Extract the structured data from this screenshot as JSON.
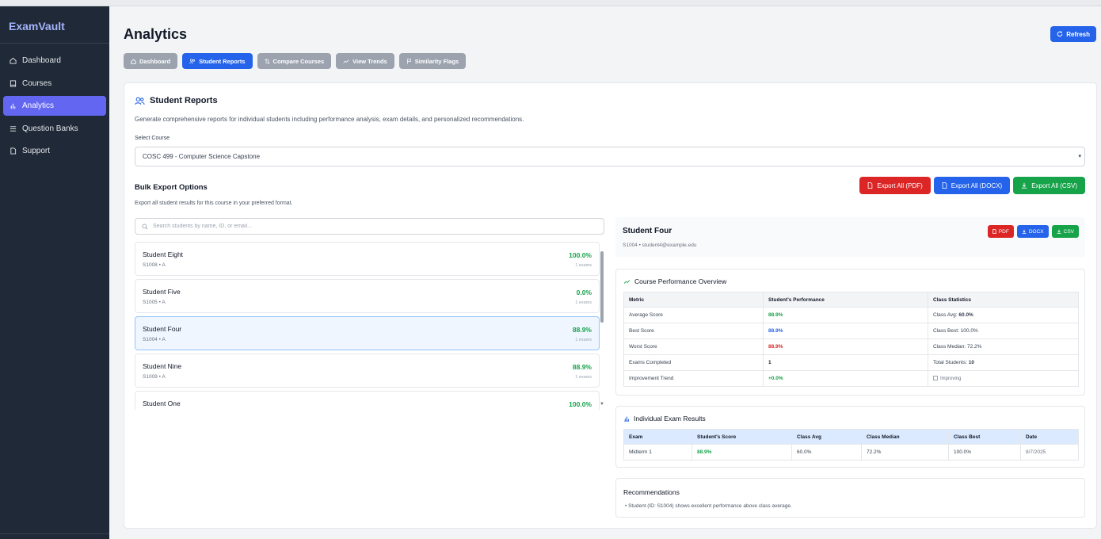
{
  "app": {
    "name": "ExamVault"
  },
  "sidebar": {
    "items": [
      {
        "label": "Dashboard",
        "icon": "home-icon",
        "active": false
      },
      {
        "label": "Courses",
        "icon": "book-icon",
        "active": false
      },
      {
        "label": "Analytics",
        "icon": "bar-chart-icon",
        "active": true
      },
      {
        "label": "Question Banks",
        "icon": "list-icon",
        "active": false
      },
      {
        "label": "Support",
        "icon": "document-icon",
        "active": false
      }
    ]
  },
  "header": {
    "title": "Analytics",
    "refresh_label": "Refresh"
  },
  "tabs": [
    {
      "label": "Dashboard",
      "icon": "home-icon"
    },
    {
      "label": "Student Reports",
      "icon": "users-icon",
      "active": true
    },
    {
      "label": "Compare Courses",
      "icon": "compare-icon"
    },
    {
      "label": "View Trends",
      "icon": "trend-icon"
    },
    {
      "label": "Similarity Flags",
      "icon": "flag-icon"
    }
  ],
  "report": {
    "title": "Student Reports",
    "description": "Generate comprehensive reports for individual students including performance analysis, exam details, and personalized recommendations.",
    "select_label": "Select Course",
    "selected_course": "COSC 499 - Computer Science Capstone",
    "bulk_title": "Bulk Export Options",
    "bulk_description": "Export all student results for this course in your preferred format.",
    "export_pdf": "Export All (PDF)",
    "export_docx": "Export All (DOCX)",
    "export_csv": "Export All (CSV)",
    "search_placeholder": "Search students by name, ID, or email..."
  },
  "students": [
    {
      "name": "Student Eight",
      "sub": "S1008 • A",
      "score": "100.0%",
      "exams": "1 exams"
    },
    {
      "name": "Student Five",
      "sub": "S1005 • A",
      "score": "0.0%",
      "exams": "1 exams"
    },
    {
      "name": "Student Four",
      "sub": "S1004 • A",
      "score": "88.9%",
      "exams": "1 exams",
      "selected": true
    },
    {
      "name": "Student Nine",
      "sub": "S1009 • A",
      "score": "88.9%",
      "exams": "1 exams"
    },
    {
      "name": "Student One",
      "sub": "",
      "score": "100.0%",
      "exams": ""
    }
  ],
  "detail": {
    "name": "Student Four",
    "sub": "S1004 • student4@example.edu",
    "pdf": "PDF",
    "docx": "DOCX",
    "csv": "CSV",
    "overview_title": "Course Performance Overview",
    "overview_headers": [
      "Metric",
      "Student's Performance",
      "Class Statistics"
    ],
    "overview_rows": [
      {
        "metric": "Average Score",
        "value": "88.9%",
        "stat_label": "Class Avg:",
        "stat_value": "60.0%"
      },
      {
        "metric": "Best Score",
        "value": "88.9%",
        "stat_label": "Class Best:",
        "stat_value": "100.0%"
      },
      {
        "metric": "Worst Score",
        "value": "88.9%",
        "stat_label": "Class Median:",
        "stat_value": "72.2%"
      },
      {
        "metric": "Exams Completed",
        "value": "1",
        "stat_label": "Total Students:",
        "stat_value": "10"
      },
      {
        "metric": "Improvement Trend",
        "value": "+0.0%",
        "stat_label": "Improving",
        "stat_value": ""
      }
    ],
    "exam_title": "Individual Exam Results",
    "exam_headers": [
      "Exam",
      "Student's Score",
      "Class Avg",
      "Class Median",
      "Class Best",
      "Date"
    ],
    "exam_rows": [
      {
        "exam": "Midterm 1",
        "score": "88.9%",
        "avg": "60.0%",
        "median": "72.2%",
        "best": "100.0%",
        "date": "8/7/2025"
      }
    ],
    "rec_title": "Recommendations",
    "rec_item": "Student (ID: S1004) shows excellent performance above class average."
  },
  "colors": {
    "accent": "#2563eb",
    "sidebar": "#1f2937",
    "active_nav": "#6366f1",
    "danger": "#dc2626",
    "success": "#16a34a"
  }
}
